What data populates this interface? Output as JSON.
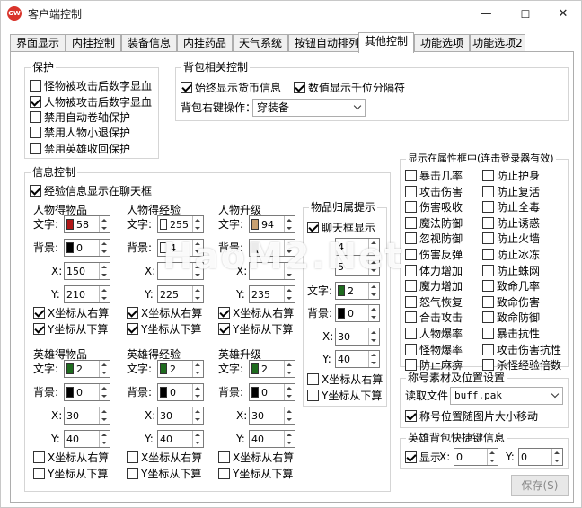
{
  "window": {
    "title": "客户端控制",
    "icon": "app-logo-icon",
    "minimize": "—",
    "maximize": "☐",
    "close": "✕"
  },
  "tabs": [
    "界面显示",
    "内挂控制",
    "装备信息",
    "内挂药品",
    "天气系统",
    "按钮自动排列",
    "其他控制",
    "功能选项",
    "功能选项2"
  ],
  "active_tab": "其他控制",
  "protect": {
    "title": "保护",
    "items": [
      {
        "label": "怪物被攻击后数字显血",
        "checked": false
      },
      {
        "label": "人物被攻击后数字显血",
        "checked": true
      },
      {
        "label": "禁用自动卷轴保护",
        "checked": false
      },
      {
        "label": "禁用人物小退保护",
        "checked": false
      },
      {
        "label": "禁用英雄收回保护",
        "checked": false
      }
    ]
  },
  "bag": {
    "title": "背包相关控制",
    "show_money": {
      "label": "始终显示货币信息",
      "checked": true
    },
    "thousand_sep": {
      "label": "数值显示千位分隔符",
      "checked": true
    },
    "right_click_label": "背包右键操作：",
    "right_click_value": "穿装备"
  },
  "info": {
    "title": "信息控制",
    "exp_chat": {
      "label": "经验信息显示在聊天框",
      "checked": true
    },
    "text_label": "文字:",
    "bg_label": "背景:",
    "x_label": "X:",
    "y_label": "Y:",
    "x_right_label": "X坐标从右算",
    "y_bottom_label": "Y坐标从下算",
    "blocks": [
      {
        "title": "人物得物品",
        "text": "58",
        "text_color": "#b01818",
        "bg": "0",
        "bg_color": "#000000",
        "x": "150",
        "y": "210",
        "x_right": true,
        "y_bottom": true
      },
      {
        "title": "人物得经验",
        "text": "255",
        "text_color": "#ffffff",
        "bg": "4",
        "bg_color": "#ffffff",
        "x": "",
        "y": "225",
        "x_right": true,
        "y_bottom": true
      },
      {
        "title": "人物升级",
        "text": "94",
        "text_color": "#c8a070",
        "bg": "",
        "bg_color": "#000000",
        "x": "",
        "y": "235",
        "x_right": true,
        "y_bottom": true
      },
      {
        "title": "英雄得物品",
        "text": "2",
        "text_color": "#1e6b1e",
        "bg": "0",
        "bg_color": "#000000",
        "x": "30",
        "y": "40",
        "x_right": false,
        "y_bottom": false
      },
      {
        "title": "英雄得经验",
        "text": "2",
        "text_color": "#1e6b1e",
        "bg": "0",
        "bg_color": "#000000",
        "x": "30",
        "y": "40",
        "x_right": false,
        "y_bottom": false
      },
      {
        "title": "英雄升级",
        "text": "2",
        "text_color": "#1e6b1e",
        "bg": "0",
        "bg_color": "#000000",
        "x": "30",
        "y": "40",
        "x_right": false,
        "y_bottom": false
      }
    ],
    "owner": {
      "title": "物品归属提示",
      "chat_show": {
        "label": "聊天框显示",
        "checked": true
      },
      "text": "2",
      "text_color": "#1e6b1e",
      "bg": "0",
      "bg_color": "#000000",
      "x": "30",
      "y": "40",
      "partial_x": "4",
      "partial_y": "5",
      "x_right": false,
      "y_bottom": false
    }
  },
  "attr": {
    "title": "显示在属性框中(连击登录器有效)",
    "left": [
      "暴击几率",
      "攻击伤害",
      "伤害吸收",
      "魔法防御",
      "忽视防御",
      "伤害反弹",
      "体力增加",
      "魔力增加",
      "怒气恢复",
      "合击攻击",
      "人物爆率",
      "怪物爆率",
      "防止麻痹"
    ],
    "right": [
      "防止护身",
      "防止复活",
      "防止全毒",
      "防止诱惑",
      "防止火墙",
      "防止冰冻",
      "防止蛛网",
      "致命几率",
      "致命伤害",
      "致命防御",
      "暴击抗性",
      "攻击伤害抗性",
      "杀怪经验倍数"
    ]
  },
  "title_mat": {
    "title": "称号素材及位置设置",
    "file_label": "读取文件",
    "file_value": "buff.pak",
    "follow": {
      "label": "称号位置随图片大小移动",
      "checked": true
    }
  },
  "hero_bag": {
    "title": "英雄背包快捷键信息",
    "show": {
      "label": "显示",
      "checked": true
    },
    "x_label": "X:",
    "x_value": "0",
    "y_label": "Y:",
    "y_value": "0"
  },
  "save_label": "保存(S)",
  "watermark": "HaoM2.Net"
}
